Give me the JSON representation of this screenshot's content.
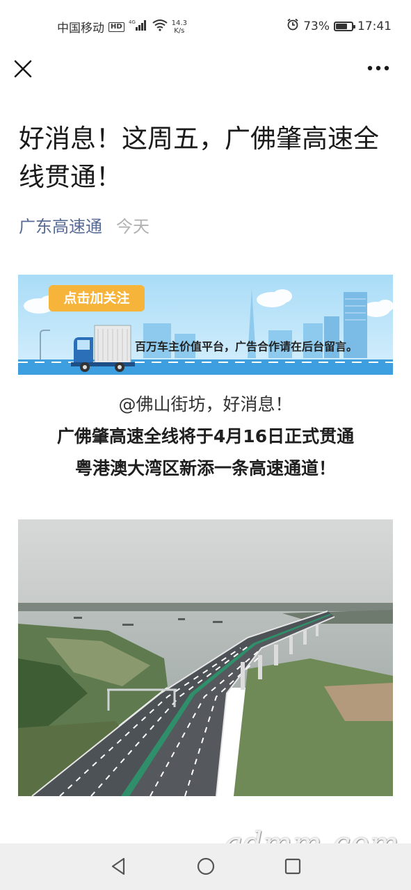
{
  "status_bar": {
    "carrier": "中国移动",
    "hd_badge": "HD",
    "network": "4G",
    "speed_value": "14.3",
    "speed_unit": "K/s",
    "battery_percent": "73%",
    "battery_level": 0.73,
    "time": "17:41",
    "icons": [
      "signal-icon",
      "wifi-icon",
      "alarm-icon",
      "battery-icon"
    ]
  },
  "top_bar": {
    "close_icon": "close-icon",
    "more_icon": "more-icon"
  },
  "article": {
    "title": "好消息！这周五，广佛肇高速全线贯通！",
    "account": "广东高速通",
    "date": "今天",
    "banner": {
      "button_label": "点击加关注",
      "slogan": "百万车主价值平台，广告合作请在后台留言。"
    },
    "lead_lines": [
      "@佛山街坊，好消息！",
      "广佛肇高速全线将于4月16日正式贯通",
      "粤港澳大湾区新添一条高速通道！"
    ]
  },
  "watermark": "gdmm.com",
  "nav_bar": {
    "icons": [
      "back-icon",
      "home-icon",
      "recent-apps-icon"
    ]
  }
}
